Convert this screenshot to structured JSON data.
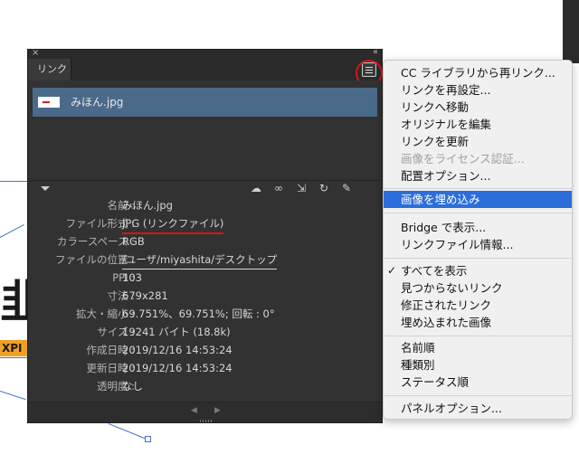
{
  "panel": {
    "tab_label": "リンク",
    "close_glyph": "×",
    "collapse_glyph": "‹‹",
    "file": {
      "name": "みほん.jpg"
    },
    "info": [
      {
        "label": "名前 :",
        "value": "みほん.jpg"
      },
      {
        "label": "ファイル形式 :",
        "value": "JPG (リンクファイル)"
      },
      {
        "label": "カラースペース :",
        "value": "RGB"
      },
      {
        "label": "ファイルの位置 :",
        "value": "/ユーザ/miyashita/デスクトップ"
      },
      {
        "label": "PPI :",
        "value": "103"
      },
      {
        "label": "寸法 :",
        "value": "679x281"
      },
      {
        "label": "拡大・縮小 :",
        "value": "69.751%、69.751%; 回転 : 0°"
      },
      {
        "label": "サイズ :",
        "value": "19241 バイト (18.8k)"
      },
      {
        "label": "作成日時 :",
        "value": "2019/12/16 14:53:24"
      },
      {
        "label": "更新日時 :",
        "value": "2019/12/16 14:53:24"
      },
      {
        "label": "透明度 :",
        "value": "なし"
      }
    ],
    "toolbar_icons": [
      "cloud-link-icon",
      "relink-icon",
      "goto-link-icon",
      "update-link-icon",
      "edit-original-icon"
    ]
  },
  "background": {
    "big_text": "韭",
    "label_text": "XPI"
  },
  "menu": {
    "items": [
      "CC ライブラリから再リンク...",
      "リンクを再設定...",
      "リンクへ移動",
      "オリジナルを編集",
      "リンクを更新",
      "画像をライセンス認証...",
      "配置オプション...",
      "画像を埋め込み",
      "Bridge で表示...",
      "リンクファイル情報...",
      "すべてを表示",
      "見つからないリンク",
      "修正されたリンク",
      "埋め込まれた画像",
      "名前順",
      "種類別",
      "ステータス順",
      "パネルオプション..."
    ],
    "check_glyph": "✓"
  },
  "colors": {
    "panel_bg": "#323232",
    "selected_row": "#4b6a8a",
    "menu_highlight": "#2b6ed9",
    "annotation_red": "#d8141a"
  }
}
